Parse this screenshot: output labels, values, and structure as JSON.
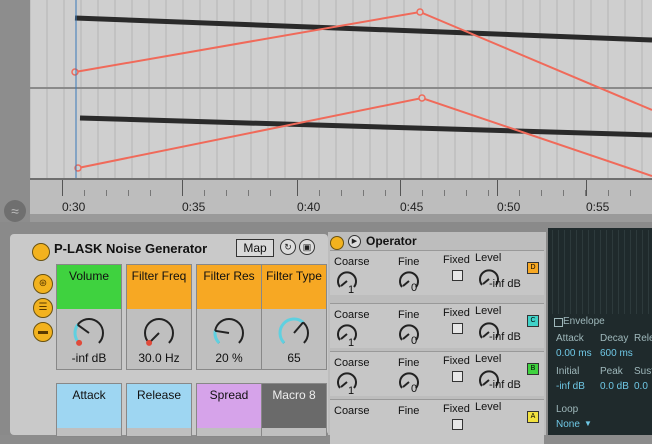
{
  "arrangement": {
    "timeline_ticks": [
      "0:30",
      "0:35",
      "0:40",
      "0:45",
      "0:50",
      "0:55"
    ]
  },
  "rack": {
    "title": "P-LASK Noise Generator",
    "map_label": "Map",
    "macros": [
      {
        "name": "Volume",
        "value": "-inf dB",
        "color": "#3fd23f",
        "level": 0.3
      },
      {
        "name": "Filter Freq",
        "value": "30.0 Hz",
        "color": "#f7a823",
        "level": 0.0
      },
      {
        "name": "Filter Res",
        "value": "20 %",
        "color": "#f7a823",
        "level": 0.2
      },
      {
        "name": "Filter Type",
        "value": "65",
        "color": "#f7a823",
        "level": 0.65
      },
      {
        "name": "Attack",
        "value": "",
        "color": "#9ed6f2"
      },
      {
        "name": "Release",
        "value": "",
        "color": "#9ed6f2"
      },
      {
        "name": "Spread",
        "value": "",
        "color": "#d6a3ea"
      },
      {
        "name": "Macro 8",
        "value": "",
        "color": "#6a6a6a"
      }
    ]
  },
  "operator": {
    "title": "Operator",
    "rows": [
      {
        "coarse_label": "Coarse",
        "coarse": "1",
        "fine_label": "Fine",
        "fine": "0",
        "fixed_label": "Fixed",
        "level_label": "Level",
        "level": "-inf dB",
        "badge": "D",
        "badge_color": "#f7a823"
      },
      {
        "coarse_label": "Coarse",
        "coarse": "1",
        "fine_label": "Fine",
        "fine": "0",
        "fixed_label": "Fixed",
        "level_label": "Level",
        "level": "-inf dB",
        "badge": "C",
        "badge_color": "#3fd2c8"
      },
      {
        "coarse_label": "Coarse",
        "coarse": "1",
        "fine_label": "Fine",
        "fine": "0",
        "fixed_label": "Fixed",
        "level_label": "Level",
        "level": "-inf dB",
        "badge": "B",
        "badge_color": "#3fd23f"
      },
      {
        "coarse_label": "Coarse",
        "fine_label": "Fine",
        "fixed_label": "Fixed",
        "level_label": "Level",
        "badge": "A",
        "badge_color": "#f2e23f"
      }
    ]
  },
  "envelope": {
    "title": "Envelope",
    "attack_label": "Attack",
    "attack": "0.00 ms",
    "decay_label": "Decay",
    "decay": "600 ms",
    "release_label": "Relea",
    "initial_label": "Initial",
    "initial": "-inf dB",
    "peak_label": "Peak",
    "peak": "0.0 dB",
    "sustain_label": "Sust",
    "sustain": "0.0",
    "loop_label": "Loop",
    "loop": "None"
  },
  "colors": {
    "automation_line": "#f06a5a",
    "note_bar": "#2a2a2a",
    "accent": "#f2b21e"
  }
}
